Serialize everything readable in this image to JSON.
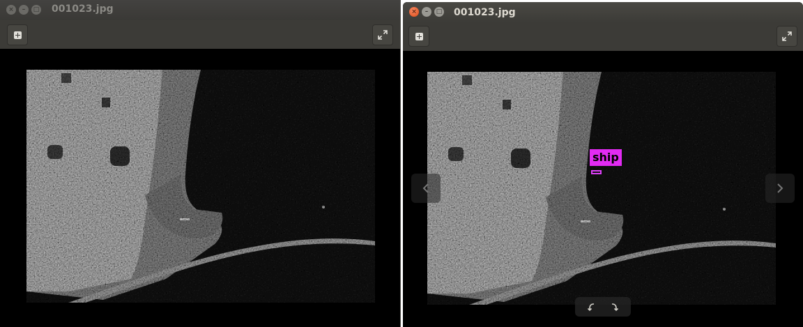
{
  "left_window": {
    "title": "001023.jpg",
    "buttons": {
      "close": "×",
      "minimize": "–",
      "maximize": "□"
    }
  },
  "right_window": {
    "title": "001023.jpg",
    "buttons": {
      "close": "×",
      "minimize": "–",
      "maximize": "□"
    },
    "detection": {
      "label": "ship",
      "color": "#e22bf3"
    }
  },
  "colors": {
    "titlebar": "#3c3b37",
    "close_button": "#df4a16",
    "canvas": "#000000"
  }
}
